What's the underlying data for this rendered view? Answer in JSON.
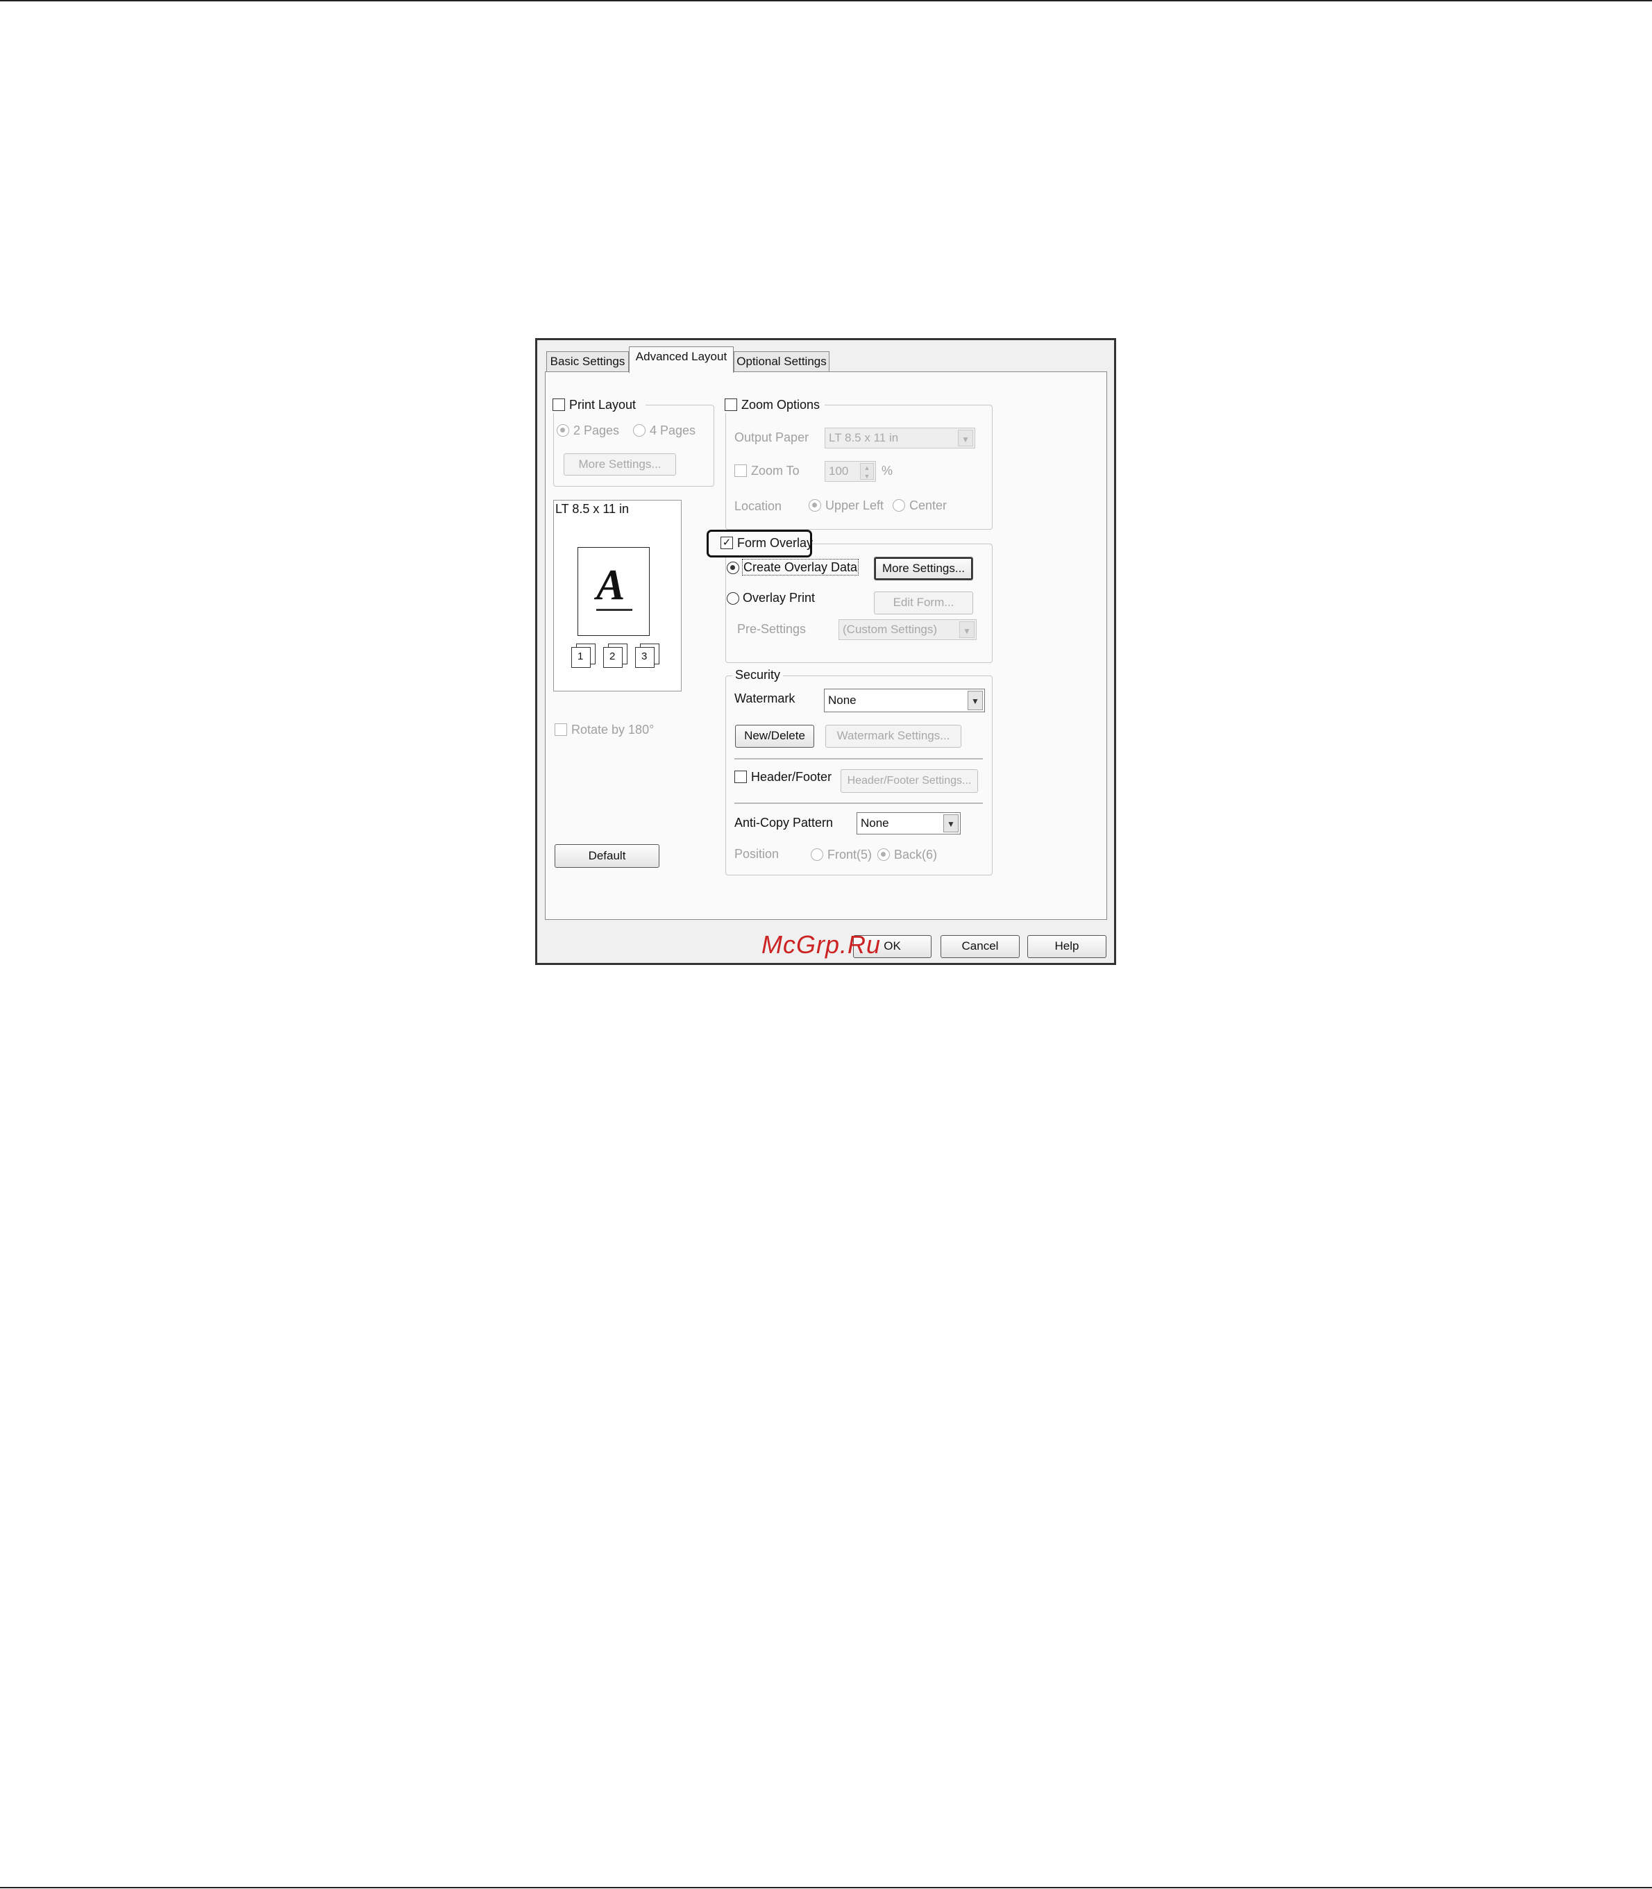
{
  "tabs": [
    "Basic Settings",
    "Advanced Layout",
    "Optional Settings"
  ],
  "print_layout": {
    "label": "Print Layout",
    "checked": false,
    "option_2pages": "2 Pages",
    "option_4pages": "4 Pages",
    "more_settings": "More Settings..."
  },
  "preview": {
    "paper": "LT 8.5 x 11 in",
    "letter": "A",
    "page_numbers": [
      "1",
      "2",
      "3"
    ]
  },
  "rotate": {
    "label": "Rotate by 180°",
    "checked": false
  },
  "default_button": "Default",
  "zoom_options": {
    "label": "Zoom Options",
    "checked": false,
    "output_paper_label": "Output Paper",
    "output_paper_value": "LT 8.5 x 11 in",
    "zoom_to_label": "Zoom To",
    "zoom_to_value": "100",
    "zoom_unit": "%",
    "location_label": "Location",
    "location_upper_left": "Upper Left",
    "location_center": "Center"
  },
  "form_overlay": {
    "label": "Form Overlay",
    "checked": true,
    "create_overlay_data": "Create Overlay Data",
    "more_settings": "More Settings...",
    "overlay_print": "Overlay Print",
    "edit_form": "Edit Form...",
    "pre_settings_label": "Pre-Settings",
    "pre_settings_value": "(Custom Settings)"
  },
  "security": {
    "label": "Security",
    "watermark_label": "Watermark",
    "watermark_value": "None",
    "new_delete": "New/Delete",
    "watermark_settings": "Watermark Settings...",
    "header_footer_label": "Header/Footer",
    "header_footer_checked": false,
    "header_footer_settings": "Header/Footer Settings...",
    "anti_copy_label": "Anti-Copy Pattern",
    "anti_copy_value": "None",
    "position_label": "Position",
    "position_front": "Front(5)",
    "position_back": "Back(6)"
  },
  "buttons": {
    "ok": "OK",
    "cancel": "Cancel",
    "help": "Help"
  },
  "watermark_text": "McGrp.Ru",
  "colors": {
    "watermark": "#cc2222",
    "highlight": "#111111"
  }
}
